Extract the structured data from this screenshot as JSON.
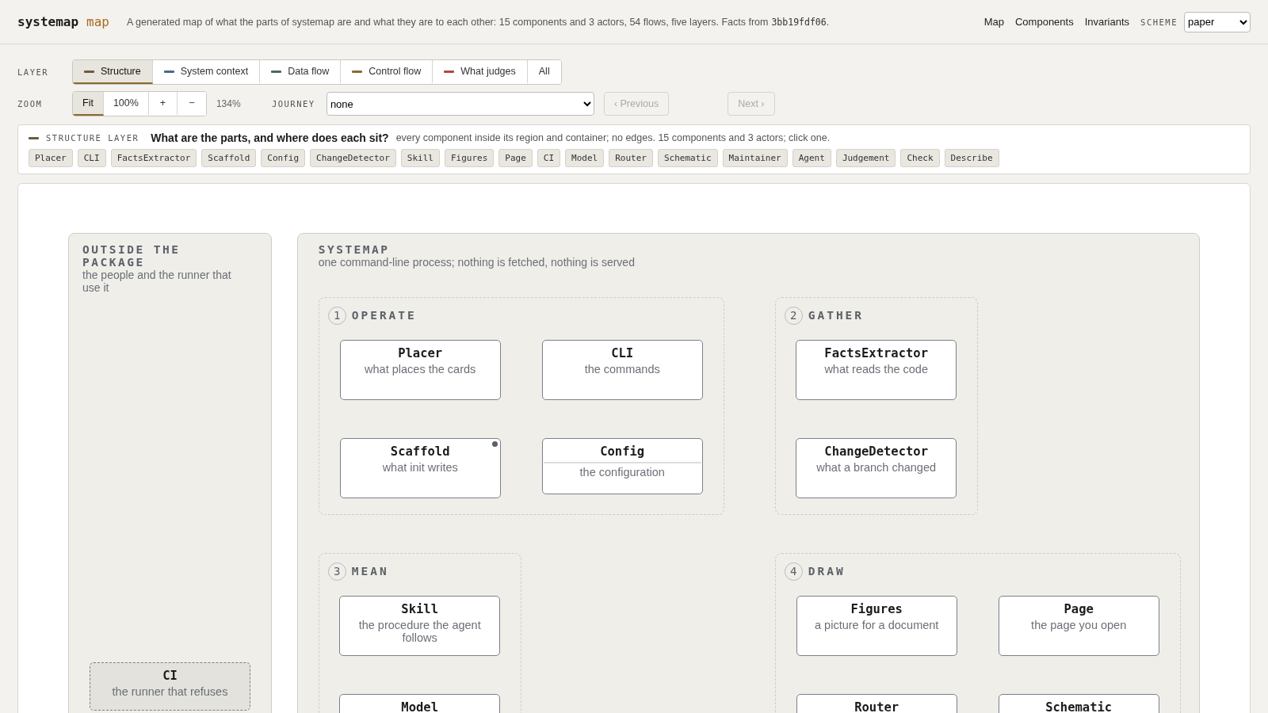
{
  "header": {
    "brand": "systemap",
    "brand_suffix": "map",
    "description": "A generated map of what the parts of systemap are and what they are to each other: 15 components and 3 actors, 54 flows, five layers. Facts from",
    "facts_hash": "3bb19fdf06",
    "facts_end": "."
  },
  "nav": [
    "Map",
    "Components",
    "Invariants"
  ],
  "scheme": {
    "label": "SCHEME",
    "value": "paper"
  },
  "layer": {
    "label": "LAYER",
    "tabs": [
      {
        "label": "Structure",
        "color": "#6b5b3e",
        "selected": true
      },
      {
        "label": "System context",
        "color": "#4a6788",
        "selected": false
      },
      {
        "label": "Data flow",
        "color": "#4a6a5c",
        "selected": false
      },
      {
        "label": "Control flow",
        "color": "#8a6a2e",
        "selected": false
      },
      {
        "label": "What judges",
        "color": "#b0493c",
        "selected": false
      },
      {
        "label": "All",
        "selected": false
      }
    ]
  },
  "zoom": {
    "label": "ZOOM",
    "buttons": [
      {
        "label": "Fit",
        "selected": true
      },
      {
        "label": "100%",
        "selected": false
      },
      {
        "label": "+",
        "selected": false
      },
      {
        "label": "−",
        "selected": false
      }
    ],
    "reading": "134%"
  },
  "journey": {
    "label": "JOURNEY",
    "value": "none",
    "previous": {
      "label": "‹ Previous",
      "disabled": true
    },
    "next": {
      "label": "Next ›",
      "disabled": true
    }
  },
  "layer_info": {
    "label": "STRUCTURE LAYER",
    "color": "#6b5b3e",
    "question": "What are the parts, and where does each sit?",
    "note": "every component inside its region and container; no edges. 15 components and 3 actors; click one.",
    "chips": [
      "Placer",
      "CLI",
      "FactsExtractor",
      "Scaffold",
      "Config",
      "ChangeDetector",
      "Skill",
      "Figures",
      "Page",
      "CI",
      "Model",
      "Router",
      "Schematic",
      "Maintainer",
      "Agent",
      "Judgement",
      "Check",
      "Describe"
    ]
  },
  "canvas": {
    "outside": {
      "title": "OUTSIDE THE PACKAGE",
      "subtitle": "the people and the runner that use it",
      "cards": [
        {
          "name": "CI",
          "role": "the runner that refuses",
          "kind": "actor",
          "flagged": false
        }
      ]
    },
    "system": {
      "title": "SYSTEMAP",
      "subtitle": "one command-line process; nothing is fetched, nothing is served",
      "regions": [
        {
          "number": "1",
          "title": "OPERATE",
          "cards": [
            {
              "name": "Placer",
              "role": "what places the cards",
              "kind": "plain",
              "flagged": false
            },
            {
              "name": "CLI",
              "role": "the commands",
              "kind": "plain",
              "flagged": false
            },
            {
              "name": "Scaffold",
              "role": "what init writes",
              "kind": "plain",
              "flagged": true
            },
            {
              "name": "Config",
              "role": "the configuration",
              "kind": "split",
              "flagged": false
            }
          ]
        },
        {
          "number": "2",
          "title": "GATHER",
          "cards": [
            {
              "name": "FactsExtractor",
              "role": "what reads the code",
              "kind": "plain",
              "flagged": false
            },
            {
              "name": "ChangeDetector",
              "role": "what a branch changed",
              "kind": "plain",
              "flagged": false
            }
          ]
        },
        {
          "number": "3",
          "title": "MEAN",
          "cards": [
            {
              "name": "Skill",
              "role": "the procedure the agent follows",
              "kind": "plain",
              "flagged": false
            },
            {
              "name": "Model",
              "kind": "plain",
              "flagged": false
            }
          ]
        },
        {
          "number": "4",
          "title": "DRAW",
          "cards": [
            {
              "name": "Figures",
              "role": "a picture for a document",
              "kind": "plain",
              "flagged": false
            },
            {
              "name": "Page",
              "role": "the page you open",
              "kind": "plain",
              "flagged": false
            },
            {
              "name": "Router",
              "kind": "plain",
              "flagged": false
            },
            {
              "name": "Schematic",
              "kind": "plain",
              "flagged": false
            }
          ]
        }
      ]
    }
  }
}
